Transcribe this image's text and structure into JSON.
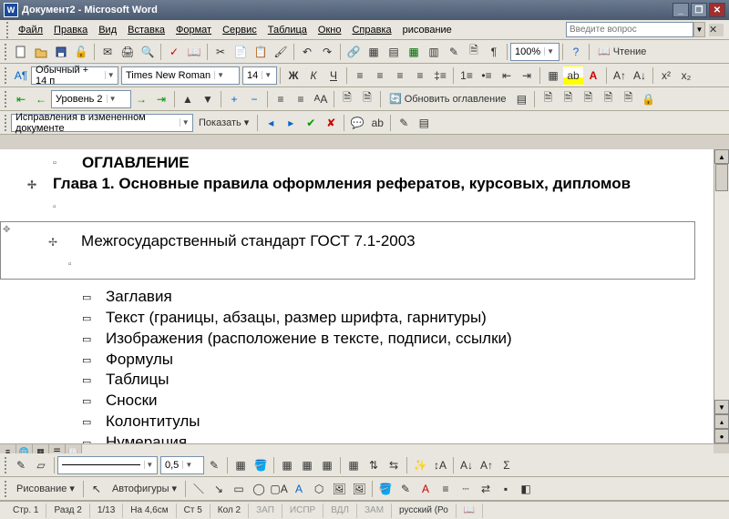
{
  "title": "Документ2 - Microsoft Word",
  "menubar": [
    "Файл",
    "Правка",
    "Вид",
    "Вставка",
    "Формат",
    "Сервис",
    "Таблица",
    "Окно",
    "Справка",
    "рисование"
  ],
  "ask_placeholder": "Введите вопрос",
  "tb1": {
    "zoom": "100%",
    "reading": "Чтение"
  },
  "tb2": {
    "style": "Обычный + 14 п",
    "font": "Times New Roman",
    "size": "14"
  },
  "tb3": {
    "level": "Уровень 2",
    "update_toc": "Обновить оглавление"
  },
  "tb4": {
    "track": "Исправления в измененном документе",
    "show": "Показать"
  },
  "tb5": {
    "weight": "0,5"
  },
  "tb6": {
    "drawing": "Рисование",
    "autoshapes": "Автофигуры"
  },
  "doc": {
    "h1": "ОГЛАВЛЕНИЕ",
    "h2": "Глава 1. Основные правила оформления рефератов, курсовых, дипломов",
    "boxed": "Межгосударственный стандарт ГОСТ 7.1-2003",
    "items": [
      "Заглавия",
      "Текст (границы, абзацы, размер шрифта, гарнитуры)",
      "Изображения (расположение в тексте, подписи, ссылки)",
      "Формулы",
      "Таблицы",
      "Сноски",
      "Колонтитулы",
      "Нумерация"
    ]
  },
  "status": {
    "page": "Стр. 1",
    "sec": "Разд 2",
    "pages": "1/13",
    "at": "На  4,6см",
    "ln": "Ст  5",
    "col": "Кол  2",
    "rec": "ЗАП",
    "trk": "ИСПР",
    "ext": "ВДЛ",
    "ovr": "ЗАМ",
    "lang": "русский (Ро"
  }
}
